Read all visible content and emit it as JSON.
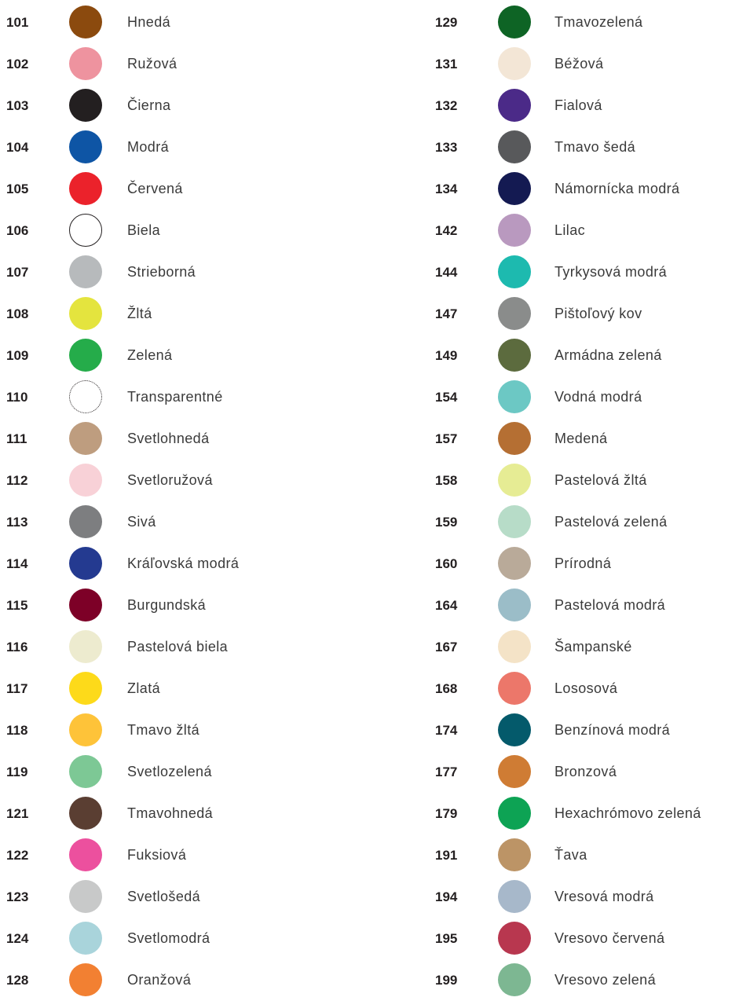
{
  "left_column": [
    {
      "code": "101",
      "name": "Hnedá",
      "color": "#8B4A0E"
    },
    {
      "code": "102",
      "name": "Ružová",
      "color": "#EE939F"
    },
    {
      "code": "103",
      "name": "Čierna",
      "color": "#231F20"
    },
    {
      "code": "104",
      "name": "Modrá",
      "color": "#0E55A5"
    },
    {
      "code": "105",
      "name": "Červená",
      "color": "#EB222B"
    },
    {
      "code": "106",
      "name": "Biela",
      "color": "#FFFFFF",
      "style": "outline"
    },
    {
      "code": "107",
      "name": "Strieborná",
      "color": "#B7BABC"
    },
    {
      "code": "108",
      "name": "Žltá",
      "color": "#E4E43E"
    },
    {
      "code": "109",
      "name": "Zelená",
      "color": "#25AC4A"
    },
    {
      "code": "110",
      "name": "Transparentné",
      "color": "#FFFFFF",
      "style": "dotted"
    },
    {
      "code": "111",
      "name": "Svetlohnedá",
      "color": "#BE9D7F"
    },
    {
      "code": "112",
      "name": "Svetloružová",
      "color": "#F8D1D7"
    },
    {
      "code": "113",
      "name": "Sivá",
      "color": "#7D7E80"
    },
    {
      "code": "114",
      "name": "Kráľovská modrá",
      "color": "#243A90"
    },
    {
      "code": "115",
      "name": "Burgundská",
      "color": "#7D0027"
    },
    {
      "code": "116",
      "name": "Pastelová biela",
      "color": "#EDEBCF"
    },
    {
      "code": "117",
      "name": "Zlatá",
      "color": "#FDDA1A"
    },
    {
      "code": "118",
      "name": "Tmavo žltá",
      "color": "#FEC339"
    },
    {
      "code": "119",
      "name": "Svetlozelená",
      "color": "#7DC895"
    },
    {
      "code": "121",
      "name": "Tmavohnedá",
      "color": "#5A3E32"
    },
    {
      "code": "122",
      "name": "Fuksiová",
      "color": "#EC509E"
    },
    {
      "code": "123",
      "name": "Svetlošedá",
      "color": "#C8C9C9"
    },
    {
      "code": "124",
      "name": "Svetlomodrá",
      "color": "#A9D4DB"
    },
    {
      "code": "128",
      "name": "Oranžová",
      "color": "#F28032"
    }
  ],
  "right_column": [
    {
      "code": "129",
      "name": "Tmavozelená",
      "color": "#0E6425"
    },
    {
      "code": "131",
      "name": "Béžová",
      "color": "#F3E6D6"
    },
    {
      "code": "132",
      "name": "Fialová",
      "color": "#4B2A88"
    },
    {
      "code": "133",
      "name": "Tmavo šedá",
      "color": "#58595B"
    },
    {
      "code": "134",
      "name": "Námornícka modrá",
      "color": "#141A52"
    },
    {
      "code": "142",
      "name": "Lilac",
      "color": "#B999BF"
    },
    {
      "code": "144",
      "name": "Tyrkysová modrá",
      "color": "#1DBAAF"
    },
    {
      "code": "147",
      "name": "Pištoľový kov",
      "color": "#8A8C8B"
    },
    {
      "code": "149",
      "name": "Armádna zelená",
      "color": "#5C6B3E"
    },
    {
      "code": "154",
      "name": "Vodná modrá",
      "color": "#6CC8C4"
    },
    {
      "code": "157",
      "name": "Medená",
      "color": "#B56F33"
    },
    {
      "code": "158",
      "name": "Pastelová žltá",
      "color": "#E6EC94"
    },
    {
      "code": "159",
      "name": "Pastelová zelená",
      "color": "#B7DCC8"
    },
    {
      "code": "160",
      "name": "Prírodná",
      "color": "#B9AA99"
    },
    {
      "code": "164",
      "name": "Pastelová modrá",
      "color": "#9BBDC8"
    },
    {
      "code": "167",
      "name": "Šampanské",
      "color": "#F4E3C7"
    },
    {
      "code": "168",
      "name": "Lososová",
      "color": "#EC776A"
    },
    {
      "code": "174",
      "name": "Benzínová modrá",
      "color": "#045A6B"
    },
    {
      "code": "177",
      "name": "Bronzová",
      "color": "#CF7C34"
    },
    {
      "code": "179",
      "name": "Hexachrómovo zelená",
      "color": "#0DA354"
    },
    {
      "code": "191",
      "name": "Ťava",
      "color": "#BC9466"
    },
    {
      "code": "194",
      "name": "Vresová modrá",
      "color": "#A7B8CA"
    },
    {
      "code": "195",
      "name": "Vresovo červená",
      "color": "#B8374F"
    },
    {
      "code": "199",
      "name": "Vresovo zelená",
      "color": "#7DB792"
    }
  ]
}
